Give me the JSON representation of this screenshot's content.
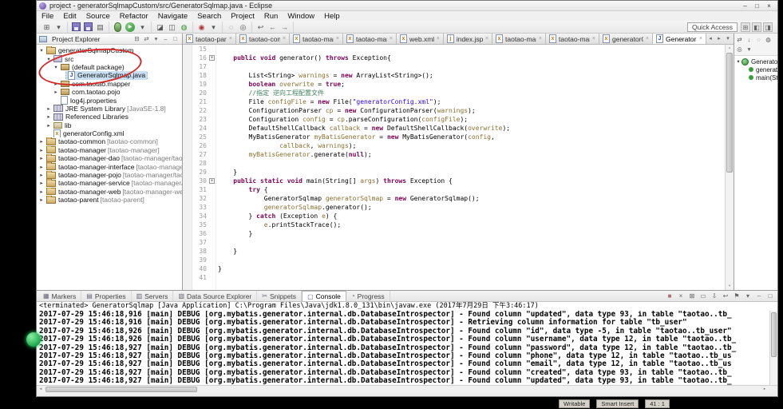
{
  "titlebar": {
    "title": "project - generatorSqlmapCustom/src/GeneratorSqlmap.java - Eclipse",
    "controls": [
      {
        "name": "minimize-button",
        "glyph": "–"
      },
      {
        "name": "maximize-button",
        "glyph": "□"
      },
      {
        "name": "close-button",
        "glyph": "×"
      }
    ]
  },
  "menubar": [
    "File",
    "Edit",
    "Source",
    "Refactor",
    "Navigate",
    "Search",
    "Project",
    "Run",
    "Window",
    "Help"
  ],
  "toolbar": {
    "quick_access": "Quick Access",
    "groups": [
      [
        {
          "name": "new-wizard-icon",
          "glyph": "⊞"
        },
        {
          "name": "new-wizard-dropdown-icon",
          "glyph": "▾"
        }
      ],
      [
        {
          "name": "save-icon",
          "glyph": ""
        },
        {
          "name": "save-all-icon",
          "glyph": ""
        },
        {
          "name": "print-icon",
          "glyph": "▤"
        }
      ],
      [
        {
          "name": "debug-icon",
          "glyph": ""
        },
        {
          "name": "run-icon",
          "glyph": "▶"
        },
        {
          "name": "run-dropdown-icon",
          "glyph": "▾"
        }
      ],
      [
        {
          "name": "new-java-project-icon",
          "glyph": "◪"
        },
        {
          "name": "new-package-icon",
          "glyph": "◫"
        },
        {
          "name": "new-class-icon",
          "glyph": "◍",
          "color": "#2f8f2f"
        }
      ],
      [
        {
          "name": "external-tools-icon",
          "glyph": "◉",
          "color": "#b03030"
        },
        {
          "name": "external-tools-dropdown-icon",
          "glyph": "▾"
        }
      ],
      [
        {
          "name": "search-icon",
          "glyph": "◌"
        },
        {
          "name": "open-type-icon",
          "glyph": "◎"
        }
      ],
      [
        {
          "name": "last-edit-location-icon",
          "glyph": "↩"
        },
        {
          "name": "back-icon",
          "glyph": "←"
        },
        {
          "name": "forward-icon",
          "glyph": "→"
        }
      ]
    ],
    "perspectives": [
      {
        "name": "open-perspective-icon",
        "glyph": "⊞"
      },
      {
        "name": "perspective-javaee-icon",
        "glyph": "◧"
      },
      {
        "name": "perspective-java-icon",
        "glyph": "◨"
      }
    ]
  },
  "explorer": {
    "title": "Project Explorer",
    "toolbar_icons": [
      {
        "name": "collapse-all-icon",
        "glyph": "⊟"
      },
      {
        "name": "link-with-editor-icon",
        "glyph": "⇄"
      },
      {
        "name": "view-menu-icon",
        "glyph": "▾"
      },
      {
        "name": "minimize-panel-icon",
        "glyph": "–"
      },
      {
        "name": "maximize-panel-icon",
        "glyph": "□"
      }
    ],
    "tree": [
      {
        "label": "generatorSqlmapCustom",
        "level": 0,
        "icon": "project",
        "expand": "open"
      },
      {
        "label": "src",
        "level": 1,
        "icon": "src",
        "expand": "open"
      },
      {
        "label": "(default package)",
        "level": 2,
        "icon": "package",
        "expand": "open"
      },
      {
        "label": "GeneratorSqlmap.java",
        "level": 3,
        "icon": "java",
        "selected": true
      },
      {
        "label": "com.taotao.mapper",
        "level": 2,
        "icon": "package",
        "expand": "closed"
      },
      {
        "label": "com.taotao.pojo",
        "level": 2,
        "icon": "package",
        "expand": "closed"
      },
      {
        "label": "log4j.properties",
        "level": 2,
        "icon": "file"
      },
      {
        "label": "JRE System Library",
        "suffix": "[JavaSE-1.8]",
        "level": 1,
        "icon": "library",
        "expand": "closed"
      },
      {
        "label": "Referenced Libraries",
        "level": 1,
        "icon": "library",
        "expand": "closed"
      },
      {
        "label": "lib",
        "level": 1,
        "icon": "folder",
        "expand": "closed"
      },
      {
        "label": "generatorConfig.xml",
        "level": 1,
        "icon": "xml"
      },
      {
        "label": "taotao-common",
        "suffix": "[taotao-common]",
        "level": 0,
        "icon": "project",
        "expand": "closed"
      },
      {
        "label": "taotao-manager",
        "suffix": "[taotao-manager]",
        "level": 0,
        "icon": "project",
        "expand": "closed"
      },
      {
        "label": "taotao-manager-dao",
        "suffix": "[taotao-manager/taota",
        "level": 0,
        "icon": "project",
        "expand": "closed"
      },
      {
        "label": "taotao-manager-interface",
        "suffix": "[taotao-manager/t",
        "level": 0,
        "icon": "project",
        "expand": "closed"
      },
      {
        "label": "taotao-manager-pojo",
        "suffix": "[taotao-manager/taoto",
        "level": 0,
        "icon": "project",
        "expand": "closed"
      },
      {
        "label": "taotao-manager-service",
        "suffix": "[taotao-manager/ta",
        "level": 0,
        "icon": "project",
        "expand": "closed"
      },
      {
        "label": "taotao-manager-web",
        "suffix": "[taotao-manager-web]",
        "level": 0,
        "icon": "project",
        "expand": "closed"
      },
      {
        "label": "taotao-parent",
        "suffix": "[taotao-parent]",
        "level": 0,
        "icon": "project",
        "expand": "closed"
      }
    ]
  },
  "editor": {
    "tabs": [
      {
        "label": "taotao-pare",
        "icon": "xml"
      },
      {
        "label": "taotao-commo",
        "icon": "xml"
      },
      {
        "label": "taotao-manag",
        "icon": "xml"
      },
      {
        "label": "taotao-manag",
        "icon": "xml"
      },
      {
        "label": "web.xml",
        "icon": "xml"
      },
      {
        "label": "index.jsp",
        "icon": "jsp"
      },
      {
        "label": "taotao-manag",
        "icon": "xml"
      },
      {
        "label": "taotao-manag",
        "icon": "xml"
      },
      {
        "label": "generatorCo",
        "icon": "xml"
      },
      {
        "label": "GeneratorSq",
        "icon": "java",
        "active": true
      }
    ],
    "overflow_icons": [
      {
        "name": "tab-scroll-left-icon",
        "glyph": "◂"
      },
      {
        "name": "tab-scroll-right-icon",
        "glyph": "▸"
      },
      {
        "name": "tab-list-icon",
        "glyph": "▾"
      }
    ],
    "lines": [
      {
        "n": 15,
        "s": []
      },
      {
        "n": 16,
        "fold": true,
        "s": [
          [
            "p",
            "    "
          ],
          [
            "k",
            "public"
          ],
          [
            "p",
            " "
          ],
          [
            "k",
            "void"
          ],
          [
            "p",
            " generator() "
          ],
          [
            "k",
            "throws"
          ],
          [
            "p",
            " Exception{"
          ]
        ]
      },
      {
        "n": 17,
        "s": []
      },
      {
        "n": 18,
        "s": [
          [
            "p",
            "        List<String> "
          ],
          [
            "v",
            "warnings"
          ],
          [
            "p",
            " = "
          ],
          [
            "k",
            "new"
          ],
          [
            "p",
            " ArrayList<String>();"
          ]
        ]
      },
      {
        "n": 19,
        "s": [
          [
            "p",
            "        "
          ],
          [
            "k",
            "boolean"
          ],
          [
            "p",
            " "
          ],
          [
            "v",
            "overwrite"
          ],
          [
            "p",
            " = "
          ],
          [
            "k",
            "true"
          ],
          [
            "p",
            ";"
          ]
        ]
      },
      {
        "n": 20,
        "s": [
          [
            "p",
            "        "
          ],
          [
            "c",
            "//指定 逆向工程配置文件"
          ]
        ]
      },
      {
        "n": 21,
        "s": [
          [
            "p",
            "        File "
          ],
          [
            "v",
            "configFile"
          ],
          [
            "p",
            " = "
          ],
          [
            "k",
            "new"
          ],
          [
            "p",
            " File("
          ],
          [
            "s",
            "\"generatorConfig.xml\""
          ],
          [
            "p",
            ");"
          ]
        ]
      },
      {
        "n": 22,
        "s": [
          [
            "p",
            "        ConfigurationParser "
          ],
          [
            "v",
            "cp"
          ],
          [
            "p",
            " = "
          ],
          [
            "k",
            "new"
          ],
          [
            "p",
            " ConfigurationParser("
          ],
          [
            "v",
            "warnings"
          ],
          [
            "p",
            ");"
          ]
        ]
      },
      {
        "n": 23,
        "s": [
          [
            "p",
            "        Configuration "
          ],
          [
            "v",
            "config"
          ],
          [
            "p",
            " = "
          ],
          [
            "v",
            "cp"
          ],
          [
            "p",
            ".parseConfiguration("
          ],
          [
            "v",
            "configFile"
          ],
          [
            "p",
            ");"
          ]
        ]
      },
      {
        "n": 24,
        "s": [
          [
            "p",
            "        DefaultShellCallback "
          ],
          [
            "v",
            "callback"
          ],
          [
            "p",
            " = "
          ],
          [
            "k",
            "new"
          ],
          [
            "p",
            " DefaultShellCallback("
          ],
          [
            "v",
            "overwrite"
          ],
          [
            "p",
            ");"
          ]
        ]
      },
      {
        "n": 25,
        "s": [
          [
            "p",
            "        MyBatisGenerator "
          ],
          [
            "v",
            "myBatisGenerator"
          ],
          [
            "p",
            " = "
          ],
          [
            "k",
            "new"
          ],
          [
            "p",
            " MyBatisGenerator("
          ],
          [
            "v",
            "config"
          ],
          [
            "p",
            ","
          ]
        ]
      },
      {
        "n": 26,
        "s": [
          [
            "p",
            "                "
          ],
          [
            "v",
            "callback"
          ],
          [
            "p",
            ", "
          ],
          [
            "v",
            "warnings"
          ],
          [
            "p",
            ");"
          ]
        ]
      },
      {
        "n": 27,
        "s": [
          [
            "p",
            "        "
          ],
          [
            "v",
            "myBatisGenerator"
          ],
          [
            "p",
            ".generate("
          ],
          [
            "k",
            "null"
          ],
          [
            "p",
            ");"
          ]
        ]
      },
      {
        "n": 28,
        "s": []
      },
      {
        "n": 29,
        "s": [
          [
            "p",
            "    }"
          ]
        ]
      },
      {
        "n": 30,
        "fold": true,
        "s": [
          [
            "p",
            "    "
          ],
          [
            "k",
            "public"
          ],
          [
            "p",
            " "
          ],
          [
            "k",
            "static"
          ],
          [
            "p",
            " "
          ],
          [
            "k",
            "void"
          ],
          [
            "p",
            " main(String[] "
          ],
          [
            "v",
            "args"
          ],
          [
            "p",
            ") "
          ],
          [
            "k",
            "throws"
          ],
          [
            "p",
            " Exception {"
          ]
        ]
      },
      {
        "n": 31,
        "s": [
          [
            "p",
            "        "
          ],
          [
            "k",
            "try"
          ],
          [
            "p",
            " {"
          ]
        ]
      },
      {
        "n": 32,
        "s": [
          [
            "p",
            "            GeneratorSqlmap "
          ],
          [
            "v",
            "generatorSqlmap"
          ],
          [
            "p",
            " = "
          ],
          [
            "k",
            "new"
          ],
          [
            "p",
            " GeneratorSqlmap();"
          ]
        ]
      },
      {
        "n": 33,
        "s": [
          [
            "p",
            "            "
          ],
          [
            "v",
            "generatorSqlmap"
          ],
          [
            "p",
            ".generator();"
          ]
        ]
      },
      {
        "n": 34,
        "s": [
          [
            "p",
            "        } "
          ],
          [
            "k",
            "catch"
          ],
          [
            "p",
            " (Exception "
          ],
          [
            "v",
            "e"
          ],
          [
            "p",
            ") {"
          ]
        ]
      },
      {
        "n": 35,
        "s": [
          [
            "p",
            "            "
          ],
          [
            "v",
            "e"
          ],
          [
            "p",
            ".printStackTrace();"
          ]
        ]
      },
      {
        "n": 36,
        "s": [
          [
            "p",
            "        }"
          ]
        ]
      },
      {
        "n": 37,
        "s": []
      },
      {
        "n": 38,
        "s": [
          [
            "p",
            "    }"
          ]
        ]
      },
      {
        "n": 39,
        "s": []
      },
      {
        "n": 40,
        "s": [
          [
            "p",
            "}"
          ]
        ]
      },
      {
        "n": 41,
        "s": []
      }
    ]
  },
  "outline": {
    "toolbar_icons": [
      {
        "name": "focus-icon",
        "glyph": "⇄"
      },
      {
        "name": "sort-icon",
        "glyph": "↓"
      },
      {
        "name": "hide-fields-icon",
        "glyph": "◌"
      },
      {
        "name": "hide-static-icon",
        "glyph": "◍"
      },
      {
        "name": "hide-non-public-icon",
        "glyph": "◎"
      },
      {
        "name": "view-menu-icon",
        "glyph": "▾"
      }
    ],
    "items": [
      {
        "label": "GeneratorSqlmap",
        "level": 0,
        "icon": "class",
        "expand": "open"
      },
      {
        "label": "generator()",
        "level": 1,
        "icon": "method"
      },
      {
        "label": "main(String[] args)",
        "level": 1,
        "icon": "method"
      }
    ]
  },
  "console": {
    "tabs": [
      {
        "label": "Markers",
        "icon": "▦"
      },
      {
        "label": "Properties",
        "icon": "▤"
      },
      {
        "label": "Servers",
        "icon": "▥"
      },
      {
        "label": "Data Source Explorer",
        "icon": "▧"
      },
      {
        "label": "Snippets",
        "icon": "✂"
      },
      {
        "label": "Console",
        "icon": "▢",
        "active": true
      },
      {
        "label": "Progress",
        "icon": "◔"
      }
    ],
    "toolbar_icons": [
      {
        "name": "terminate-icon",
        "glyph": "■",
        "color": "#b07070"
      },
      {
        "name": "remove-launch-icon",
        "glyph": "×"
      },
      {
        "name": "remove-all-launches-icon",
        "glyph": "⊠"
      },
      {
        "name": "clear-console-icon",
        "glyph": "▭"
      },
      {
        "name": "scroll-lock-icon",
        "glyph": "⇩"
      },
      {
        "name": "word-wrap-icon",
        "glyph": "↩"
      },
      {
        "name": "pin-console-icon",
        "glyph": "⚑"
      },
      {
        "name": "open-console-dropdown-icon",
        "glyph": "▾"
      },
      {
        "name": "minimize-panel-icon",
        "glyph": "–"
      },
      {
        "name": "maximize-panel-icon",
        "glyph": "□"
      }
    ],
    "header": "<terminated> GeneratorSqlmap [Java Application] C:\\Program Files\\Java\\jdk1.8.0_131\\bin\\javaw.exe (2017年7月29日 下午3:46:17)",
    "lines": [
      "2017-07-29 15:46:18,916 [main] DEBUG [org.mybatis.generator.internal.db.DatabaseIntrospector] - Found column \"updated\", data type 93, in table \"taotao..tb_",
      "2017-07-29 15:46:18,916 [main] DEBUG [org.mybatis.generator.internal.db.DatabaseIntrospector] - Retrieving column information for table \"tb_user\"",
      "2017-07-29 15:46:18,926 [main] DEBUG [org.mybatis.generator.internal.db.DatabaseIntrospector] - Found column \"id\", data type -5, in table \"taotao..tb_user\"",
      "2017-07-29 15:46:18,926 [main] DEBUG [org.mybatis.generator.internal.db.DatabaseIntrospector] - Found column \"username\", data type 12, in table \"taotao..tb_",
      "2017-07-29 15:46:18,927 [main] DEBUG [org.mybatis.generator.internal.db.DatabaseIntrospector] - Found column \"password\", data type 12, in table \"taotao..tb_",
      "2017-07-29 15:46:18,927 [main] DEBUG [org.mybatis.generator.internal.db.DatabaseIntrospector] - Found column \"phone\", data type 12, in table \"taotao..tb_us",
      "2017-07-29 15:46:18,927 [main] DEBUG [org.mybatis.generator.internal.db.DatabaseIntrospector] - Found column \"email\", data type 12, in table \"taotao..tb_us",
      "2017-07-29 15:46:18,927 [main] DEBUG [org.mybatis.generator.internal.db.DatabaseIntrospector] - Found column \"created\", data type 93, in table \"taotao..tb_",
      "2017-07-29 15:46:18,927 [main] DEBUG [org.mybatis.generator.internal.db.DatabaseIntrospector] - Found column \"updated\", data type 93, in table \"taotao..tb_"
    ]
  },
  "statusbar": {
    "fields": [
      "Writable",
      "Smart Insert",
      "41 : 1"
    ]
  }
}
